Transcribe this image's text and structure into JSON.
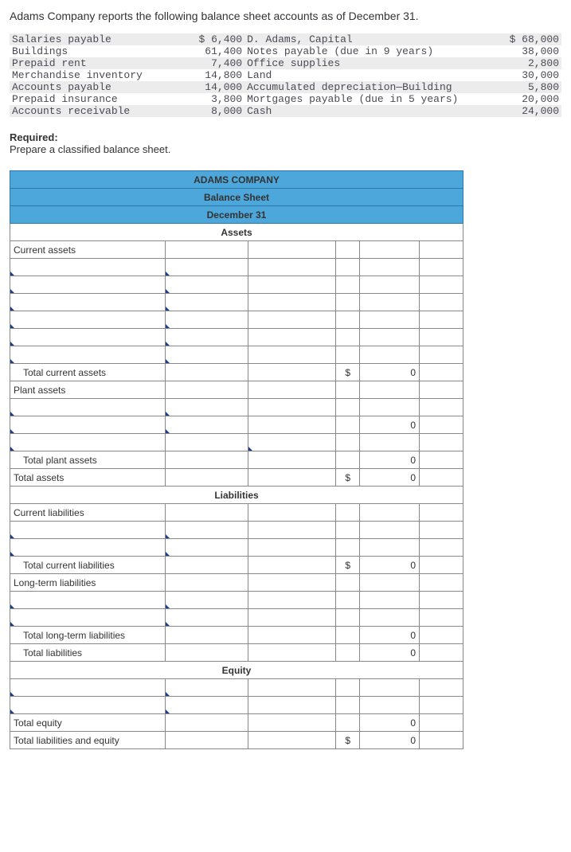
{
  "intro": "Adams Company reports the following balance sheet accounts as of December 31.",
  "accounts": {
    "left": [
      {
        "label": "Salaries payable",
        "amount": "$ 6,400"
      },
      {
        "label": "Buildings",
        "amount": "61,400"
      },
      {
        "label": "Prepaid rent",
        "amount": "7,400"
      },
      {
        "label": "Merchandise inventory",
        "amount": "14,800"
      },
      {
        "label": "Accounts payable",
        "amount": "14,000"
      },
      {
        "label": "Prepaid insurance",
        "amount": "3,800"
      },
      {
        "label": "Accounts receivable",
        "amount": "8,000"
      }
    ],
    "right": [
      {
        "label": "D. Adams, Capital",
        "amount": "$ 68,000"
      },
      {
        "label": "Notes payable (due in 9 years)",
        "amount": "38,000"
      },
      {
        "label": "Office supplies",
        "amount": "2,800"
      },
      {
        "label": "Land",
        "amount": "30,000"
      },
      {
        "label": "Accumulated depreciation—Building",
        "amount": "5,800"
      },
      {
        "label": "Mortgages payable (due in 5 years)",
        "amount": "20,000"
      },
      {
        "label": "Cash",
        "amount": "24,000"
      }
    ]
  },
  "required_label": "Required:",
  "required_text": "Prepare a classified balance sheet.",
  "sheet": {
    "company": "ADAMS COMPANY",
    "title": "Balance Sheet",
    "date": "December 31",
    "assets_header": "Assets",
    "current_assets": "Current assets",
    "total_current_assets": "Total current assets",
    "plant_assets": "Plant assets",
    "total_plant_assets": "Total plant assets",
    "total_assets": "Total assets",
    "liabilities_header": "Liabilities",
    "current_liabilities": "Current liabilities",
    "total_current_liabilities": "Total current liabilities",
    "long_term_liabilities": "Long-term liabilities",
    "total_long_term_liabilities": "Total long-term liabilities",
    "total_liabilities": "Total liabilities",
    "equity_header": "Equity",
    "total_equity": "Total equity",
    "total_liab_equity": "Total liabilities and equity",
    "dollar": "$",
    "zero": "0"
  }
}
